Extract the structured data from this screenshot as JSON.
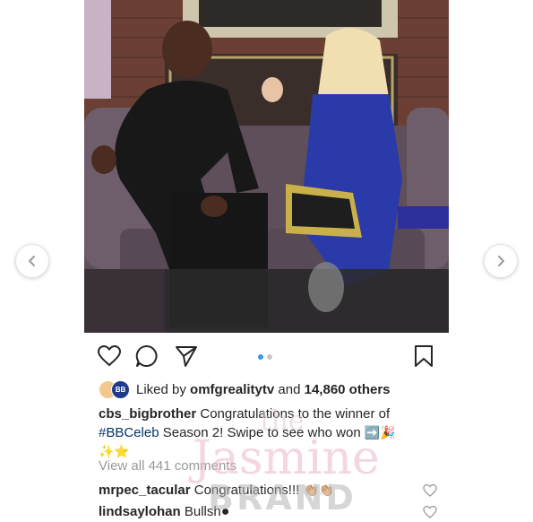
{
  "post": {
    "likes": {
      "liked_by_label": "Liked by",
      "liker": "omfgrealitytv",
      "and_label": "and",
      "others": "14,860 others",
      "avatar2_text": "BB"
    },
    "caption": {
      "username": "cbs_bigbrother",
      "text_1": "Congratulations to the winner of",
      "hashtag": "#BBCeleb",
      "text_2": "Season 2! Swipe to see who won",
      "emoji_1": "➡️🎉",
      "emoji_2": "✨⭐"
    },
    "view_all": "View all 441 comments",
    "comments": [
      {
        "username": "mrpec_tacular",
        "text": "Congratulations!!!",
        "emoji": "👏🏼👏🏼"
      },
      {
        "username": "lindsaylohan",
        "text": "Bullsh",
        "emoji": "●"
      }
    ],
    "carousel": {
      "count": 2,
      "active": 0
    }
  },
  "watermark": {
    "line1": "the",
    "line2": "Jasmine",
    "line3": "BRAND"
  },
  "icons": [
    "chevron-left-icon",
    "chevron-right-icon",
    "heart-icon",
    "comment-icon",
    "share-icon",
    "bookmark-icon"
  ]
}
